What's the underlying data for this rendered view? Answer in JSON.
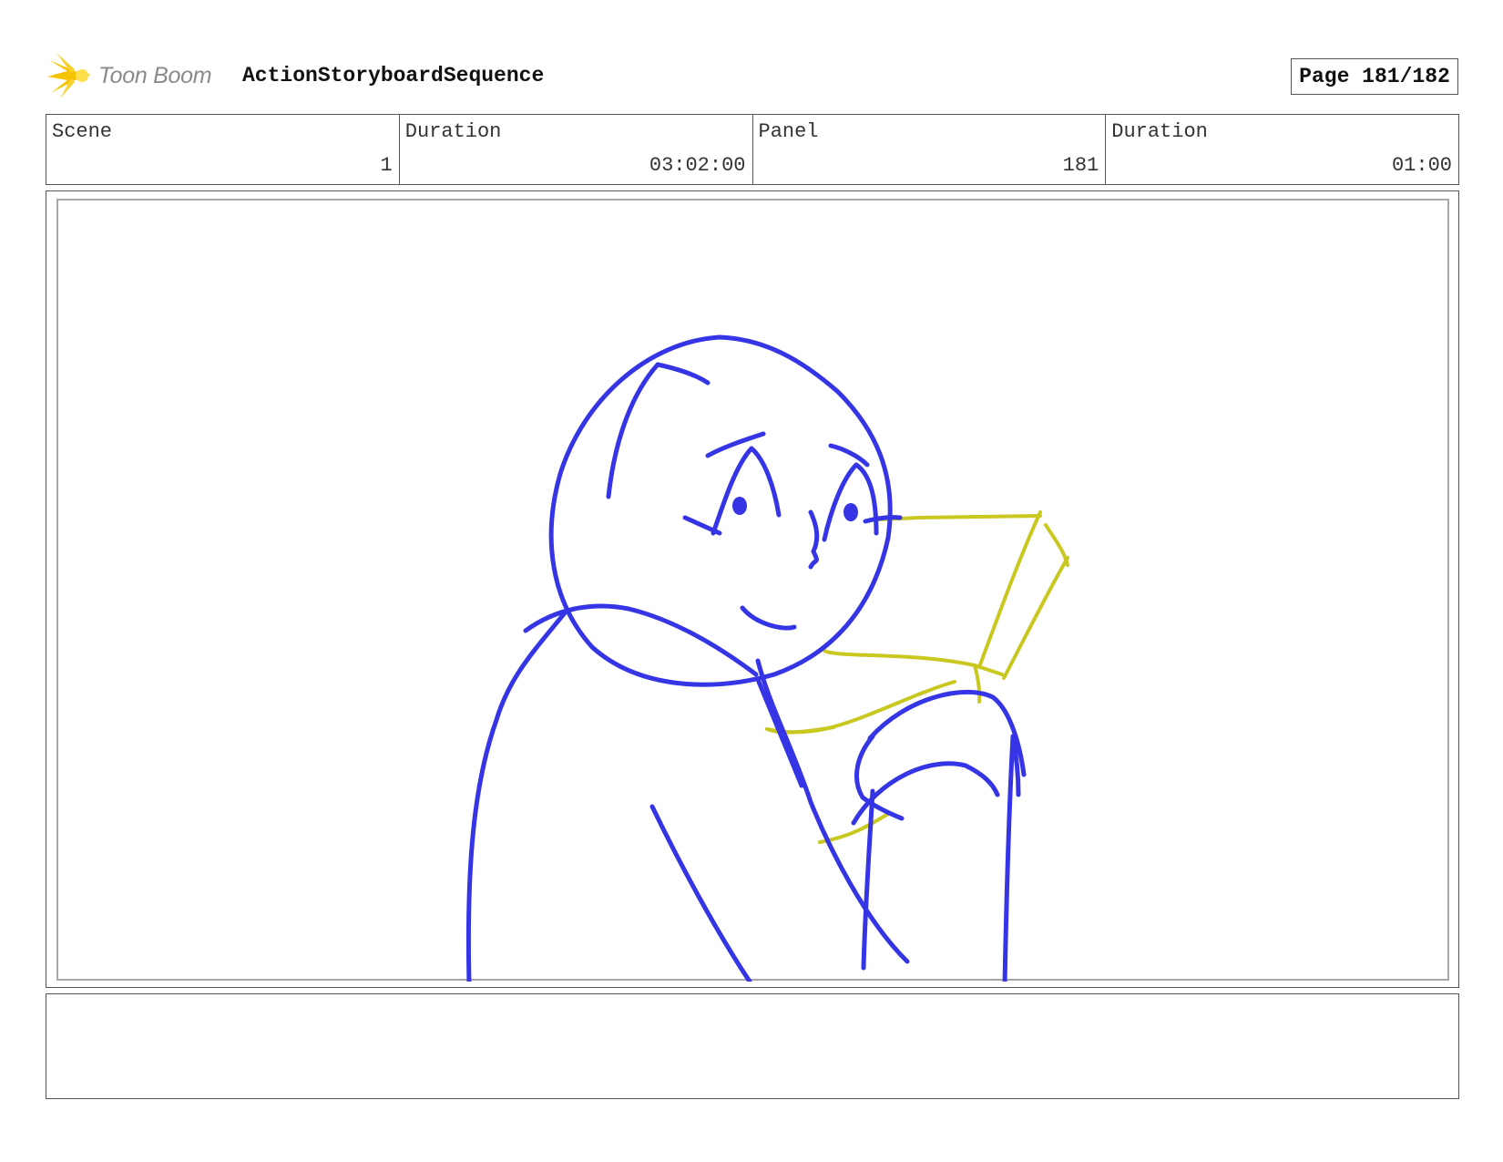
{
  "header": {
    "logo_text": "Toon Boom",
    "sequence_title": "ActionStoryboardSequence",
    "page_label": "Page 181/182"
  },
  "info": {
    "scene_label": "Scene",
    "scene_value": "1",
    "scene_duration_label": "Duration",
    "scene_duration_value": "03:02:00",
    "panel_label": "Panel",
    "panel_value": "181",
    "panel_duration_label": "Duration",
    "panel_duration_value": "01:00"
  },
  "colors": {
    "sketch_blue": "#3535e6",
    "sketch_yellow": "#c9c820",
    "logo_yellow": "#f5c400"
  },
  "notes": {
    "text": ""
  }
}
